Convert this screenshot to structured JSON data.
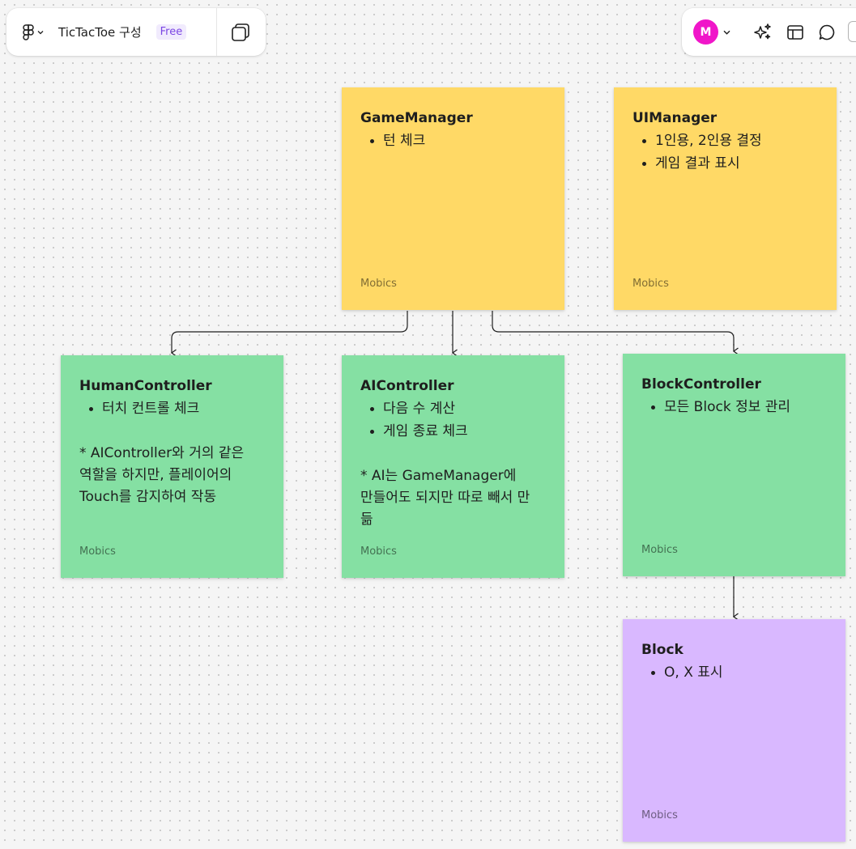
{
  "toolbar": {
    "file_name": "TicTacToe 구성",
    "plan_badge": "Free",
    "main_menu_icon": "figma-logo-icon",
    "layers_icon": "pages-icon"
  },
  "collaborators": {
    "avatar_initial": "M",
    "avatar_color": "#f016c9"
  },
  "right_tools": [
    {
      "name": "ai-sparkle-icon"
    },
    {
      "name": "template-layout-icon"
    },
    {
      "name": "comment-icon"
    }
  ],
  "colors": {
    "yellow": "#ffd966",
    "green": "#85e0a3",
    "purple": "#d9b8ff"
  },
  "stickies": {
    "game_manager": {
      "title": "GameManager",
      "bullets": [
        "턴 체크"
      ],
      "author": "Mobics"
    },
    "ui_manager": {
      "title": "UIManager",
      "bullets": [
        "1인용, 2인용 결정",
        "게임 결과 표시"
      ],
      "author": "Mobics"
    },
    "human_controller": {
      "title": "HumanController",
      "bullets": [
        "터치 컨트롤 체크"
      ],
      "note_lines": [
        "* AIController와 거의 같은",
        "역할을 하지만, 플레이어의",
        "Touch를 감지하여 작동"
      ],
      "author": "Mobics"
    },
    "ai_controller": {
      "title": "AIController",
      "bullets": [
        "다음 수 계산",
        "게임 종료 체크"
      ],
      "note_lines": [
        "* AI는 GameManager에",
        "만들어도 되지만 따로 빼서 만",
        "듦"
      ],
      "author": "Mobics"
    },
    "block_controller": {
      "title": "BlockController",
      "bullets": [
        "모든 Block 정보 관리"
      ],
      "author": "Mobics"
    },
    "block": {
      "title": "Block",
      "bullets": [
        "O, X 표시"
      ],
      "author": "Mobics"
    }
  }
}
